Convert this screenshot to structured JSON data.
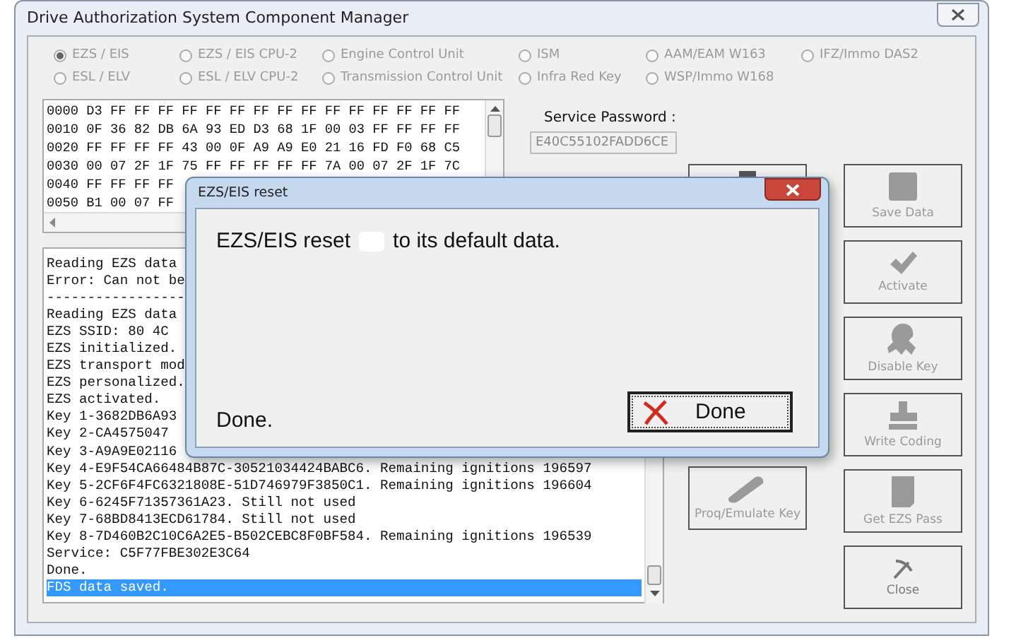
{
  "window": {
    "title": "Drive Authorization System Component Manager"
  },
  "radios": [
    {
      "label": "EZS / EIS",
      "selected": true,
      "disabled": true
    },
    {
      "label": "EZS / EIS CPU-2",
      "selected": false,
      "disabled": true
    },
    {
      "label": "Engine Control Unit",
      "selected": false,
      "disabled": true
    },
    {
      "label": "ISM",
      "selected": false,
      "disabled": true
    },
    {
      "label": "AAM/EAM W163",
      "selected": false,
      "disabled": true
    },
    {
      "label": "IFZ/Immo DAS2",
      "selected": false,
      "disabled": true
    },
    {
      "label": "ESL / ELV",
      "selected": false,
      "disabled": true
    },
    {
      "label": "ESL / ELV CPU-2",
      "selected": false,
      "disabled": true
    },
    {
      "label": "Transmission Control Unit",
      "selected": false,
      "disabled": true
    },
    {
      "label": "Infra Red Key",
      "selected": false,
      "disabled": true
    },
    {
      "label": "WSP/Immo W168",
      "selected": false,
      "disabled": true
    }
  ],
  "hex_rows": [
    "0000 D3 FF FF FF FF FF FF FF FF FF FF FF FF FF FF FF",
    "0010 0F 36 82 DB 6A 93 ED D3 68 1F 00 03 FF FF FF FF",
    "0020 FF FF FF FF 43 00 0F A9 A9 E0 21 16 FD F0 68 C5",
    "0030 00 07 2F 1F 75 FF FF FF FF FF 7A 00 07 2F 1F 7C",
    "0040 FF FF FF FF",
    "0050 B1 00 07 FF"
  ],
  "service_password": {
    "label": "Service Password :",
    "value": "E40C55102FADD6CE"
  },
  "log": [
    {
      "text": "Reading EZS data",
      "selected": false
    },
    {
      "text": "Error: Can not be",
      "selected": false
    },
    {
      "text": "-----------------",
      "selected": false
    },
    {
      "text": "Reading EZS data",
      "selected": false
    },
    {
      "text": "EZS SSID: 80 4C",
      "selected": false
    },
    {
      "text": "EZS initialized.",
      "selected": false
    },
    {
      "text": "EZS transport mod",
      "selected": false
    },
    {
      "text": "EZS personalized.",
      "selected": false
    },
    {
      "text": "EZS activated.",
      "selected": false
    },
    {
      "text": "Key 1-3682DB6A93",
      "selected": false
    },
    {
      "text": "Key 2-CA4575047",
      "selected": false
    },
    {
      "text": "Key 3-A9A9E02116",
      "selected": false
    },
    {
      "text": "Key 4-E9F54CA66484B87C-30521034424BABC6. Remaining ignitions 196597",
      "selected": false
    },
    {
      "text": "Key 5-2CF6F4FC6321808E-51D746979F3850C1. Remaining ignitions 196604",
      "selected": false
    },
    {
      "text": "Key 6-6245F71357361A23. Still not used",
      "selected": false
    },
    {
      "text": "Key 7-68BD8413ECD61784. Still not used",
      "selected": false
    },
    {
      "text": "Key 8-7D460B2C10C6A2E5-B502CEBC8F0BF584. Remaining ignitions 196539",
      "selected": false
    },
    {
      "text": "Service: C5F77FBE302E3C64",
      "selected": false
    },
    {
      "text": "Done.",
      "selected": false
    },
    {
      "text": "FDS data saved.",
      "selected": true
    }
  ],
  "middle_buttons": [
    {
      "kind": "chip"
    },
    {
      "kind": "key",
      "label": "Proq/Emulate Key",
      "disabled": true
    }
  ],
  "right_buttons": [
    {
      "kind": "save",
      "label": "Save Data",
      "disabled": true
    },
    {
      "kind": "check",
      "label": "Activate",
      "disabled": true
    },
    {
      "kind": "lock",
      "label": "Disable Key",
      "disabled": true
    },
    {
      "kind": "stamp",
      "label": "Write Coding",
      "disabled": true
    },
    {
      "kind": "card",
      "label": "Get EZS Pass",
      "disabled": true
    },
    {
      "kind": "close",
      "label": "Close",
      "disabled": false
    }
  ],
  "dialog": {
    "title": "EZS/EIS reset",
    "message": "EZS/EIS reset",
    "message_tail": "to its default data.",
    "status": "Done.",
    "button": "Done"
  }
}
